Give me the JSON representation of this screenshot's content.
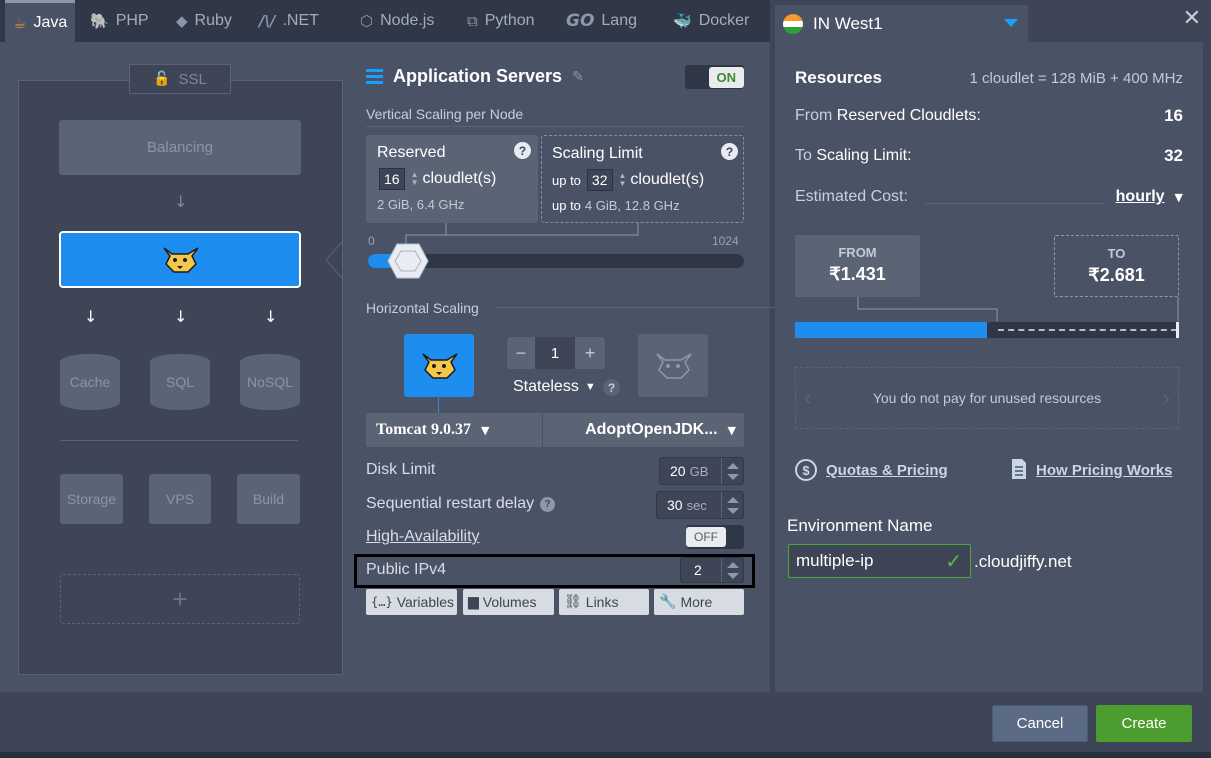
{
  "tabs": [
    {
      "label": "Java",
      "icon": "java-icon",
      "active": true
    },
    {
      "label": "PHP",
      "icon": "php-icon"
    },
    {
      "label": "Ruby",
      "icon": "ruby-icon"
    },
    {
      "label": ".NET",
      "icon": "dotnet-icon"
    },
    {
      "label": "Node.js",
      "icon": "nodejs-icon"
    },
    {
      "label": "Python",
      "icon": "python-icon"
    },
    {
      "label": "Lang",
      "icon": "go-icon",
      "prefix": "GO"
    },
    {
      "label": "Docker",
      "icon": "docker-icon"
    }
  ],
  "region": {
    "label": "IN West1",
    "icon": "india-flag-icon"
  },
  "topology": {
    "ssl": "SSL",
    "balancing": "Balancing",
    "cache": "Cache",
    "sql": "SQL",
    "nosql": "NoSQL",
    "storage": "Storage",
    "vps": "VPS",
    "build": "Build",
    "add": "+"
  },
  "app": {
    "title": "Application Servers",
    "toggle": "ON",
    "vertical_label": "Vertical Scaling per Node",
    "reserved_title": "Reserved",
    "reserved_value": "16",
    "cloudlet_unit": "cloudlet(s)",
    "reserved_specs": "2 GiB, 6.4 GHz",
    "limit_title": "Scaling Limit",
    "upto": "up to",
    "limit_value": "32",
    "limit_specs_prefix": "up to",
    "limit_specs": "4 GiB, 12.8 GHz",
    "slider_min": "0",
    "slider_max": "1024",
    "horizontal_label": "Horizontal Scaling",
    "node_count": "1",
    "minus": "−",
    "plus": "+",
    "stateless": "Stateless",
    "server": "Tomcat 9.0.37",
    "jdk": "AdoptOpenJDK...",
    "disk_label": "Disk Limit",
    "disk_value": "20",
    "disk_unit": "GB",
    "restart_label": "Sequential restart delay",
    "restart_value": "30",
    "restart_unit": "sec",
    "ha_label": "High-Availability",
    "ha_toggle": "OFF",
    "ipv4_label": "Public IPv4",
    "ipv4_value": "2",
    "btn_variables": "Variables",
    "btn_volumes": "Volumes",
    "btn_links": "Links",
    "btn_more": "More"
  },
  "resources": {
    "title": "Resources",
    "cloudlet_info": "1 cloudlet = 128 MiB + 400 MHz",
    "from_prefix": "From",
    "from_label": "Reserved Cloudlets:",
    "from_value": "16",
    "to_prefix": "To",
    "to_label": "Scaling Limit:",
    "to_value": "32",
    "cost_label": "Estimated Cost:",
    "cost_period": "hourly",
    "from_box_label": "FROM",
    "from_price": "₹1.431",
    "to_box_label": "TO",
    "to_price": "₹2.681",
    "bar_fill": 0.5,
    "unused_note": "You do not pay for unused resources",
    "quotas_link": "Quotas & Pricing",
    "pricing_link": "How Pricing Works",
    "env_label": "Environment Name",
    "env_value": "multiple-ip",
    "env_domain": ".cloudjiffy.net"
  },
  "footer": {
    "cancel": "Cancel",
    "create": "Create"
  },
  "colors": {
    "accent": "#1d8df0",
    "create": "#4a9d2e",
    "cancel": "#5b6b86",
    "panel": "#4a5365",
    "highlight": "#000000"
  }
}
